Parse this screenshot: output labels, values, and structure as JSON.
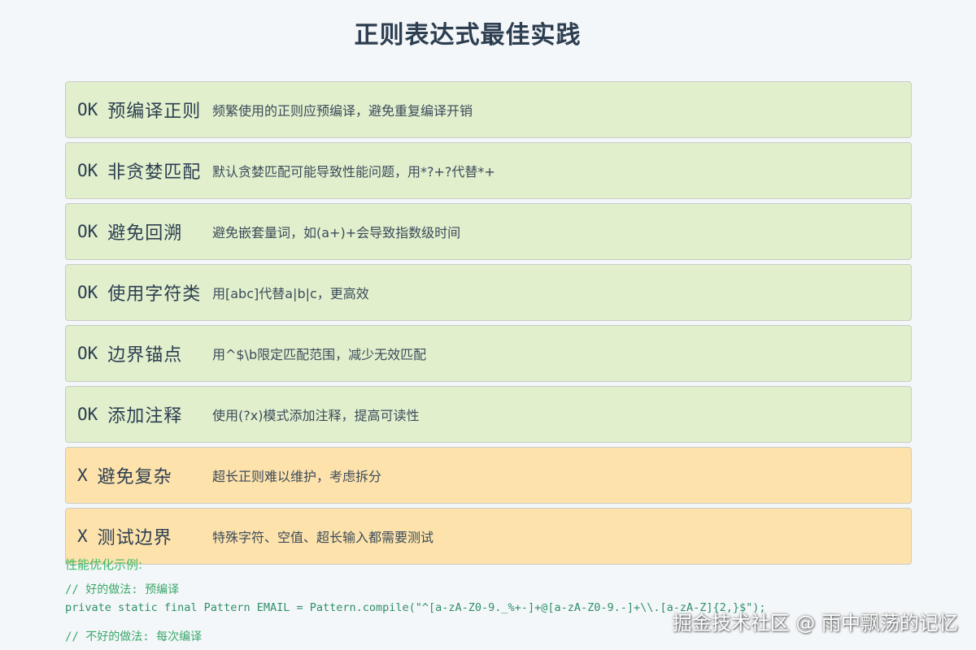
{
  "title": "正则表达式最佳实践",
  "colors": {
    "good_bg": "#e1efcd",
    "bad_bg": "#fde2ab",
    "code_green": "#3cb86a"
  },
  "cards": [
    {
      "mark": "OK",
      "title": "预编译正则",
      "desc": "频繁使用的正则应预编译，避免重复编译开销",
      "status": "good"
    },
    {
      "mark": "OK",
      "title": "非贪婪匹配",
      "desc": "默认贪婪匹配可能导致性能问题，用*?+?代替*+",
      "status": "good"
    },
    {
      "mark": "OK",
      "title": "避免回溯",
      "desc": "避免嵌套量词，如(a+)+会导致指数级时间",
      "status": "good"
    },
    {
      "mark": "OK",
      "title": "使用字符类",
      "desc": "用[abc]代替a|b|c，更高效",
      "status": "good"
    },
    {
      "mark": "OK",
      "title": "边界锚点",
      "desc": "用^$\\b限定匹配范围，减少无效匹配",
      "status": "good"
    },
    {
      "mark": "OK",
      "title": "添加注释",
      "desc": "使用(?x)模式添加注释，提高可读性",
      "status": "good"
    },
    {
      "mark": "X",
      "title": "避免复杂",
      "desc": "超长正则难以维护，考虑拆分",
      "status": "bad"
    },
    {
      "mark": "X",
      "title": "测试边界",
      "desc": "特殊字符、空值、超长输入都需要测试",
      "status": "bad"
    }
  ],
  "code": {
    "heading": "性能优化示例:",
    "comment_good": "// 好的做法: 预编译",
    "line_good": "private static final Pattern EMAIL = Pattern.compile(\"^[a-zA-Z0-9._%+-]+@[a-zA-Z0-9.-]+\\\\.[a-zA-Z]{2,}$\");",
    "comment_bad": "// 不好的做法: 每次编译"
  },
  "watermark": "掘金技术社区 @ 雨中飘荡的记忆"
}
